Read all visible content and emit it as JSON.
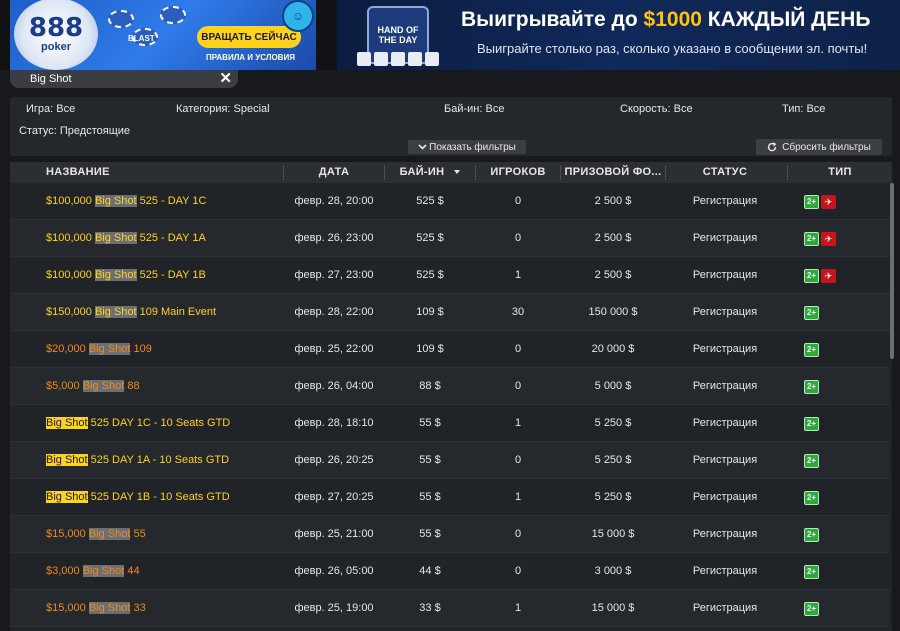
{
  "banner_left": {
    "logo_number": "888",
    "logo_word": "poker",
    "chip_label": "BLAST",
    "cta": "ВРАЩАТЬ СЕЙЧАС",
    "terms": "ПРАВИЛА И УСЛОВИЯ"
  },
  "banner_right": {
    "badge": "HAND OF THE DAY",
    "title_prefix": "Выигрывайте до ",
    "title_amount": "$1000",
    "title_suffix": " КАЖДЫЙ ДЕНЬ",
    "subtitle": "Выиграйте столько раз, сколько указано в сообщении эл. почты!"
  },
  "search": {
    "value": "Big Shot",
    "clear": "✕"
  },
  "filters": {
    "game": "Игра: Все",
    "category": "Категория: Special",
    "buyin": "Бай-ин: Все",
    "speed": "Скорость: Все",
    "type": "Тип: Все",
    "status": "Статус: Предстоящие",
    "show_filters": "Показать фильтры",
    "reset_filters": "Сбросить фильтры"
  },
  "columns": {
    "name": "НАЗВАНИЕ",
    "date": "ДАТА",
    "buyin": "БАЙ-ИН",
    "players": "ИГРОКОВ",
    "prize": "ПРИЗОВОЙ ФО...",
    "status": "СТАТУС",
    "type": "ТИП"
  },
  "rows": [
    {
      "prefix": "$100,000 ",
      "hl": "Big Shot",
      "suffix": " 525 - DAY 1C",
      "color": "yellow",
      "date": "февр. 28, 20:00",
      "buyin": "525 $",
      "players": "0",
      "prize": "2 500 $",
      "status": "Регистрация",
      "icons": [
        "2+",
        "✈"
      ]
    },
    {
      "prefix": "$100,000 ",
      "hl": "Big Shot",
      "suffix": " 525 - DAY 1A",
      "color": "yellow",
      "date": "февр. 26, 23:00",
      "buyin": "525 $",
      "players": "0",
      "prize": "2 500 $",
      "status": "Регистрация",
      "icons": [
        "2+",
        "✈"
      ]
    },
    {
      "prefix": "$100,000 ",
      "hl": "Big Shot",
      "suffix": " 525 - DAY 1B",
      "color": "yellow",
      "date": "февр. 27, 23:00",
      "buyin": "525 $",
      "players": "1",
      "prize": "2 500 $",
      "status": "Регистрация",
      "icons": [
        "2+",
        "✈"
      ]
    },
    {
      "prefix": "$150,000 ",
      "hl": "Big Shot",
      "suffix": " 109 Main Event",
      "color": "yellow",
      "date": "февр. 28, 22:00",
      "buyin": "109 $",
      "players": "30",
      "prize": "150 000 $",
      "status": "Регистрация",
      "icons": [
        "2+"
      ]
    },
    {
      "prefix": "$20,000 ",
      "hl": "Big Shot",
      "suffix": " 109",
      "color": "orange",
      "date": "февр. 25, 22:00",
      "buyin": "109 $",
      "players": "0",
      "prize": "20 000 $",
      "status": "Регистрация",
      "icons": [
        "2+"
      ]
    },
    {
      "prefix": "$5,000 ",
      "hl": "Big Shot",
      "suffix": " 88",
      "color": "orange",
      "date": "февр. 26, 04:00",
      "buyin": "88 $",
      "players": "0",
      "prize": "5 000 $",
      "status": "Регистрация",
      "icons": [
        "2+"
      ]
    },
    {
      "prefix": "",
      "hl": "Big Shot",
      "suffix": " 525 DAY 1C - 10 Seats GTD",
      "color": "yellow",
      "date": "февр. 28, 18:10",
      "buyin": "55 $",
      "players": "1",
      "prize": "5 250 $",
      "status": "Регистрация",
      "icons": [
        "2+"
      ]
    },
    {
      "prefix": "",
      "hl": "Big Shot",
      "suffix": " 525 DAY 1A - 10 Seats GTD",
      "color": "yellow",
      "date": "февр. 26, 20:25",
      "buyin": "55 $",
      "players": "0",
      "prize": "5 250 $",
      "status": "Регистрация",
      "icons": [
        "2+"
      ]
    },
    {
      "prefix": "",
      "hl": "Big Shot",
      "suffix": " 525 DAY 1B - 10 Seats GTD",
      "color": "yellow",
      "date": "февр. 27, 20:25",
      "buyin": "55 $",
      "players": "1",
      "prize": "5 250 $",
      "status": "Регистрация",
      "icons": [
        "2+"
      ]
    },
    {
      "prefix": "$15,000 ",
      "hl": "Big Shot",
      "suffix": " 55",
      "color": "orange",
      "date": "февр. 25, 21:00",
      "buyin": "55 $",
      "players": "0",
      "prize": "15 000 $",
      "status": "Регистрация",
      "icons": [
        "2+"
      ]
    },
    {
      "prefix": "$3,000 ",
      "hl": "Big Shot",
      "suffix": " 44",
      "color": "orange",
      "date": "февр. 26, 05:00",
      "buyin": "44 $",
      "players": "0",
      "prize": "3 000 $",
      "status": "Регистрация",
      "icons": [
        "2+"
      ]
    },
    {
      "prefix": "$15,000 ",
      "hl": "Big Shot",
      "suffix": " 33",
      "color": "orange",
      "date": "февр. 25, 19:00",
      "buyin": "33 $",
      "players": "1",
      "prize": "15 000 $",
      "status": "Регистрация",
      "icons": [
        "2+"
      ]
    }
  ]
}
